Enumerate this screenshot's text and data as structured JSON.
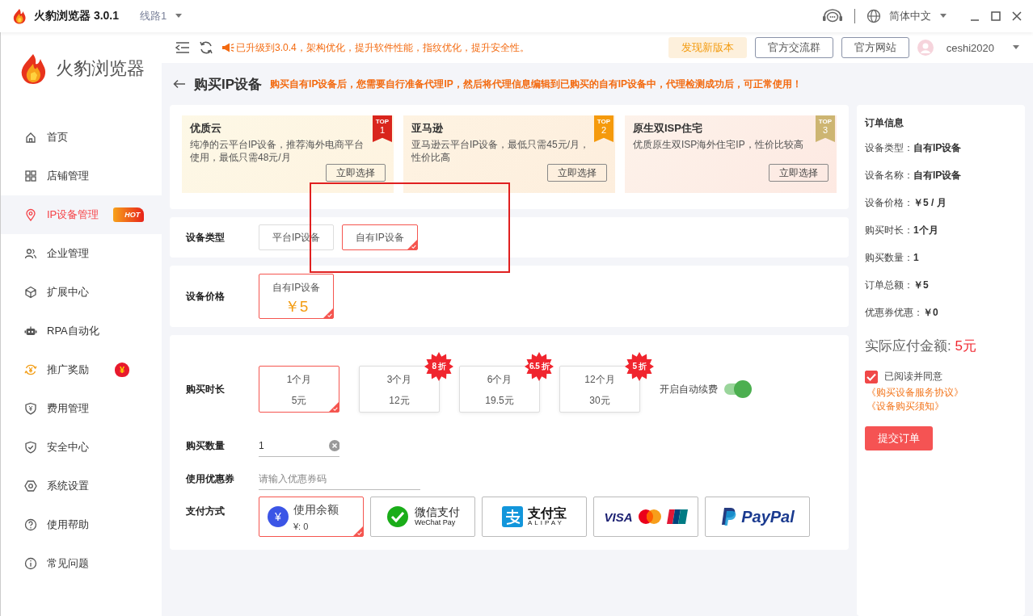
{
  "title_bar": {
    "app_name": "火豹浏览器 3.0.1",
    "line_select": "线路1",
    "language": "简体中文"
  },
  "sidebar": {
    "logo_text": "火豹浏览器",
    "items": [
      {
        "label": "首页",
        "selected": false
      },
      {
        "label": "店铺管理",
        "selected": false
      },
      {
        "label": "IP设备管理",
        "selected": true,
        "badge": {
          "kind": "hot",
          "text": "HOT"
        }
      },
      {
        "label": "企业管理",
        "selected": false
      },
      {
        "label": "扩展中心",
        "selected": false
      },
      {
        "label": "RPA自动化",
        "selected": false
      },
      {
        "label": "推广奖励",
        "selected": false,
        "badge": {
          "kind": "bag",
          "text": "¥"
        }
      },
      {
        "label": "费用管理",
        "selected": false
      },
      {
        "label": "安全中心",
        "selected": false
      },
      {
        "label": "系统设置",
        "selected": false
      },
      {
        "label": "使用帮助",
        "selected": false
      },
      {
        "label": "常见问题",
        "selected": false
      }
    ]
  },
  "toolbar": {
    "notice": "已升级到3.0.4，架构优化，提升软件性能，指纹优化，提升安全性。",
    "new_version_button": "发现新版本",
    "buttons": [
      "官方交流群",
      "官方网站"
    ],
    "user": "ceshi2020"
  },
  "page": {
    "title": "购买IP设备",
    "notice": "购买自有IP设备后，您需要自行准备代理IP，然后将代理信息编辑到已购买的自有IP设备中，代理检测成功后，可正常使用！"
  },
  "plans": [
    {
      "name": "优质云",
      "description": "纯净的云平台IP设备，推荐海外电商平台使用，最低只需48元/月",
      "rank_label": "TOP",
      "rank": "1",
      "color": "#d9251c",
      "button": "立即选择"
    },
    {
      "name": "亚马逊",
      "description": "亚马逊云平台IP设备，最低只需45元/月，性价比高",
      "rank_label": "TOP",
      "rank": "2",
      "color": "#f59a0c",
      "button": "立即选择"
    },
    {
      "name": "原生双ISP住宅",
      "description": "优质原生双ISP海外住宅IP，性价比较高",
      "rank_label": "TOP",
      "rank": "3",
      "color": "#cdb572",
      "button": "立即选择"
    }
  ],
  "device_type": {
    "label": "设备类型",
    "options": [
      {
        "label": "平台IP设备",
        "selected": false
      },
      {
        "label": "自有IP设备",
        "selected": true
      }
    ]
  },
  "device_price": {
    "label": "设备价格",
    "options": [
      {
        "name": "自有IP设备",
        "price": "￥5",
        "selected": true
      }
    ]
  },
  "duration": {
    "label": "购买时长",
    "options": [
      {
        "period": "1个月",
        "price": "5元",
        "selected": true
      },
      {
        "period": "3个月",
        "price": "12元",
        "discount": "8 折",
        "selected": false
      },
      {
        "period": "6个月",
        "price": "19.5元",
        "discount": "6.5 折",
        "selected": false
      },
      {
        "period": "12个月",
        "price": "30元",
        "discount": "5 折",
        "selected": false
      }
    ],
    "auto_renew": {
      "label": "开启自动续费",
      "on": true
    }
  },
  "quantity": {
    "label": "购买数量",
    "value": "1"
  },
  "coupon": {
    "label": "使用优惠券",
    "placeholder": "请输入优惠券码"
  },
  "payment": {
    "label": "支付方式",
    "methods": [
      {
        "kind": "balance",
        "icon_text": "¥",
        "title": "使用余额",
        "detail": "¥: 0",
        "selected": true
      },
      {
        "kind": "wechat",
        "title": "微信支付",
        "detail": "WeChat Pay",
        "selected": false
      },
      {
        "kind": "alipay",
        "title": "支付宝",
        "detail": "ALIPAY",
        "selected": false
      },
      {
        "kind": "cards",
        "title": "VISA",
        "selected": false
      },
      {
        "kind": "paypal",
        "title": "PayPal",
        "selected": false
      }
    ]
  },
  "order": {
    "title": "订单信息",
    "rows": [
      {
        "label": "设备类型：",
        "value": "自有IP设备"
      },
      {
        "label": "设备名称：",
        "value": "自有IP设备"
      },
      {
        "label": "设备价格：",
        "value": "￥5 / 月"
      },
      {
        "label": "购买时长：",
        "value": "1个月"
      },
      {
        "label": "购买数量：",
        "value": "1"
      },
      {
        "label": "订单总额：",
        "value": "￥5"
      },
      {
        "label": "优惠券优惠：",
        "value": "￥0"
      }
    ],
    "total_label": "实际应付金额:",
    "total_value": "5元",
    "agreement": {
      "label": "已阅读并同意",
      "checked": true,
      "links": [
        "《购买设备服务协议》",
        "《设备购买须知》"
      ]
    },
    "submit": "提交订单"
  },
  "annotation": {
    "kind": "rectangle"
  }
}
